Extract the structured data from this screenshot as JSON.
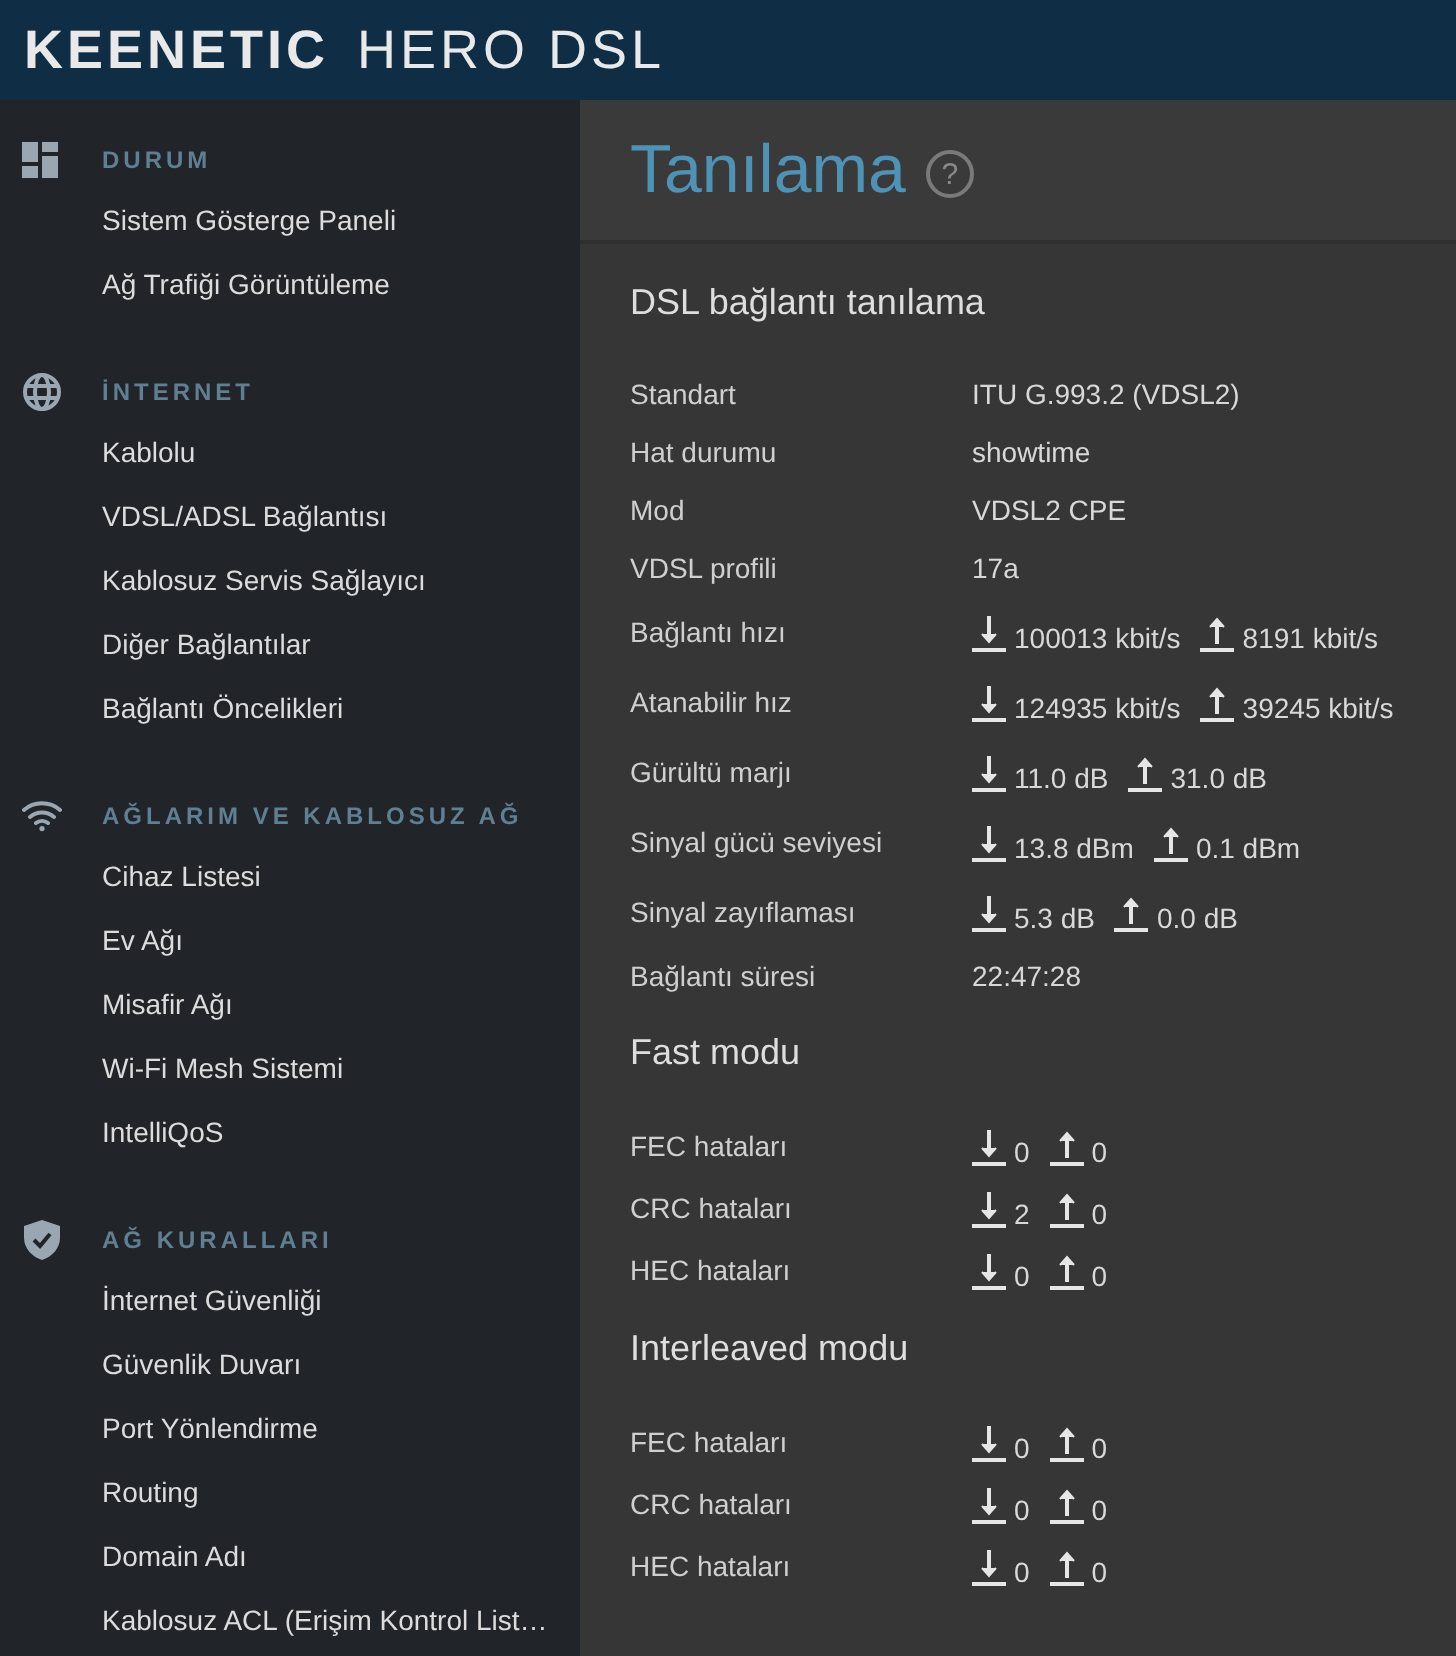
{
  "header": {
    "brand": "KEENETIC",
    "model": "HERO DSL"
  },
  "sidebar": {
    "groups": [
      {
        "heading": "DURUM",
        "items": [
          "Sistem Gösterge Paneli",
          "Ağ Trafiği Görüntüleme"
        ]
      },
      {
        "heading": "İNTERNET",
        "items": [
          "Kablolu",
          "VDSL/ADSL Bağlantısı",
          "Kablosuz Servis Sağlayıcı",
          "Diğer Bağlantılar",
          "Bağlantı Öncelikleri"
        ]
      },
      {
        "heading": "AĞLARIM VE KABLOSUZ AĞ",
        "items": [
          "Cihaz Listesi",
          "Ev Ağı",
          "Misafir Ağı",
          "Wi-Fi Mesh Sistemi",
          "IntelliQoS"
        ]
      },
      {
        "heading": "AĞ KURALLARI",
        "items": [
          "İnternet Güvenliği",
          "Güvenlik Duvarı",
          "Port Yönlendirme",
          "Routing",
          "Domain Adı",
          "Kablosuz ACL (Erişim Kontrol List…"
        ]
      }
    ]
  },
  "page": {
    "title": "Tanılama",
    "help": "?"
  },
  "sections": [
    {
      "title": "DSL bağlantı tanılama",
      "rows": [
        {
          "label": "Standart",
          "kind": "text",
          "value": "ITU G.993.2 (VDSL2)"
        },
        {
          "label": "Hat durumu",
          "kind": "text",
          "value": "showtime"
        },
        {
          "label": "Mod",
          "kind": "text",
          "value": "VDSL2 CPE"
        },
        {
          "label": "VDSL profili",
          "kind": "text",
          "value": "17a"
        },
        {
          "label": "Bağlantı hızı",
          "kind": "updown",
          "down": "100013 kbit/s",
          "up": "8191 kbit/s"
        },
        {
          "label": "Atanabilir hız",
          "kind": "updown",
          "down": "124935 kbit/s",
          "up": "39245 kbit/s"
        },
        {
          "label": "Gürültü marjı",
          "kind": "updown",
          "down": "11.0 dB",
          "up": "31.0 dB"
        },
        {
          "label": "Sinyal gücü seviyesi",
          "kind": "updown",
          "down": "13.8 dBm",
          "up": "0.1 dBm"
        },
        {
          "label": "Sinyal zayıflaması",
          "kind": "updown",
          "down": "5.3 dB",
          "up": "0.0 dB"
        },
        {
          "label": "Bağlantı süresi",
          "kind": "text",
          "value": "22:47:28"
        }
      ]
    },
    {
      "title": "Fast modu",
      "rows": [
        {
          "label": "FEC hataları",
          "kind": "counts",
          "down": "0",
          "up": "0"
        },
        {
          "label": "CRC hataları",
          "kind": "counts",
          "down": "2",
          "up": "0"
        },
        {
          "label": "HEC hataları",
          "kind": "counts",
          "down": "0",
          "up": "0"
        }
      ]
    },
    {
      "title": "Interleaved modu",
      "rows": [
        {
          "label": "FEC hataları",
          "kind": "counts",
          "down": "0",
          "up": "0"
        },
        {
          "label": "CRC hataları",
          "kind": "counts",
          "down": "0",
          "up": "0"
        },
        {
          "label": "HEC hataları",
          "kind": "counts",
          "down": "0",
          "up": "0"
        }
      ]
    }
  ]
}
